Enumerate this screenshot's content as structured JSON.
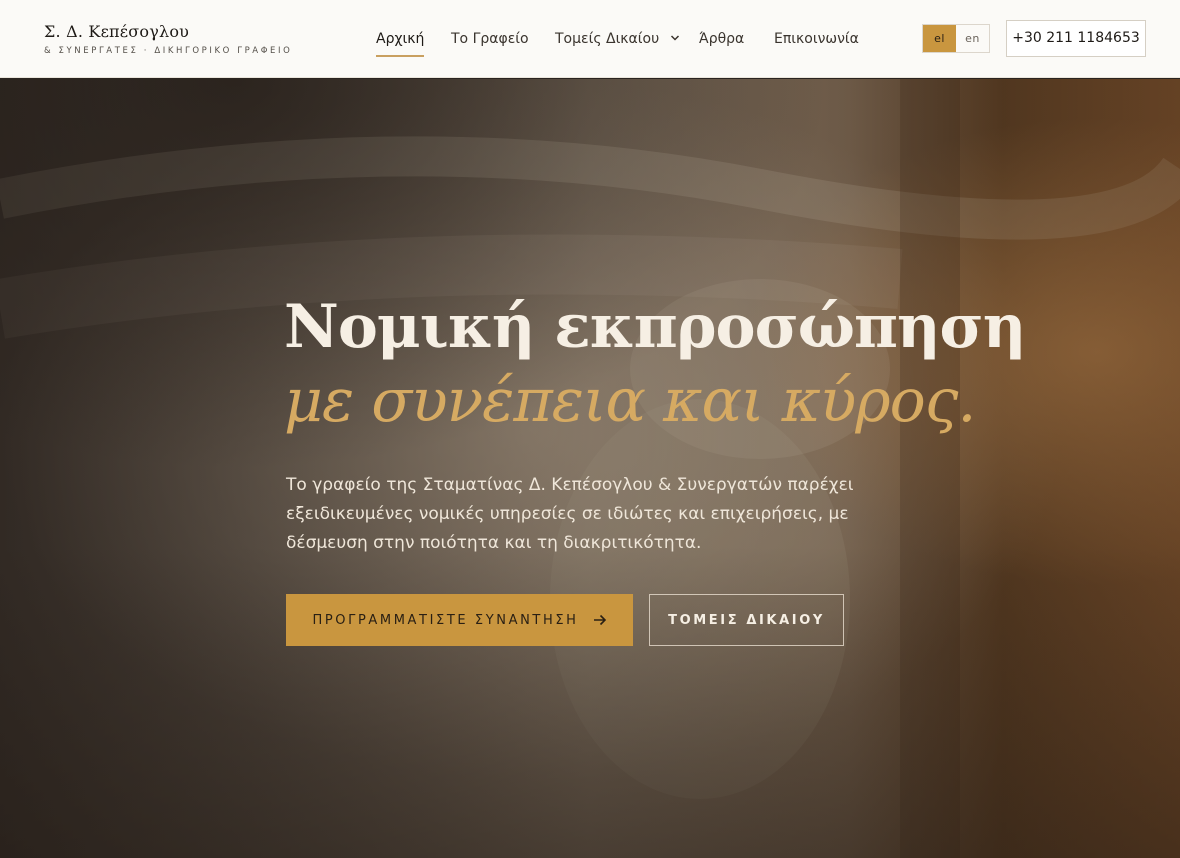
{
  "header": {
    "logo_title": "Σ. Δ. Κεπέσογλου",
    "logo_subtitle": "& ΣΥΝΕΡΓΑΤΕΣ · ΔΙΚΗΓΟΡΙΚΟ ΓΡΑΦΕΙΟ",
    "nav": {
      "home": "Αρχική",
      "office": "Το Γραφείο",
      "practice_areas": "Τομείς Δικαίου",
      "articles": "Άρθρα",
      "contact": "Επικοινωνία"
    },
    "language": {
      "el": "el",
      "en": "en",
      "selected": "el"
    },
    "phone": "+30 211 1184653"
  },
  "hero": {
    "headline_line1": "Νομική εκπροσώπηση",
    "headline_line2": "με συνέπεια και κύρος.",
    "lead": "Το γραφείο της Σταματίνας Δ. Κεπέσογλου & Συνεργατών παρέχει εξειδικευμένες νομικές υπηρεσίες σε ιδιώτες και επιχειρήσεις, με δέσμευση στην ποιότητα και τη διακριτικότητα.",
    "cta_primary": "ΠΡΟΓΡΑΜΜΑΤΙΣΤΕ ΣΥΝΑΝΤΗΣΗ",
    "cta_secondary": "ΤΟΜΕΙΣ ΔΙΚΑΙΟΥ"
  },
  "colors": {
    "accent": "#c9963f",
    "headline_italic": "#d6aa62",
    "header_bg": "#fbfaf7"
  },
  "icons": {
    "dropdown": "chevron-down-icon",
    "cta_arrow": "arrow-right-icon"
  }
}
